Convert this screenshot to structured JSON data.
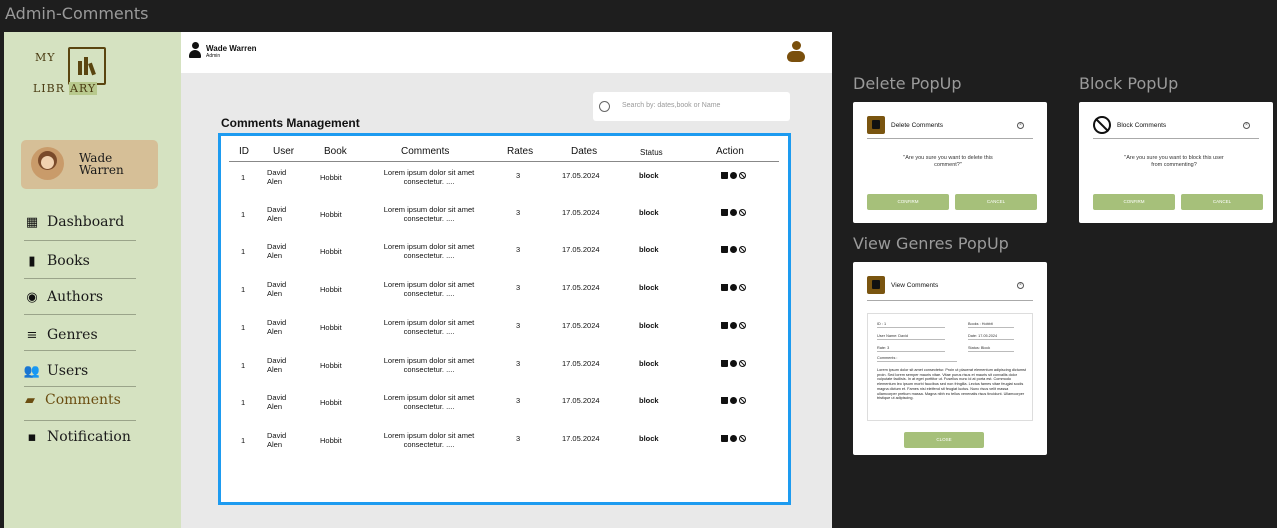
{
  "canvas_title": "Admin-Comments",
  "labels": {
    "delete_popup": "Delete PopUp",
    "block_popup": "Block PopUp",
    "view_popup": "View Genres PopUp"
  },
  "logo": {
    "w1": "MY",
    "w2": "LIBR",
    "w3": "ARY"
  },
  "profile": {
    "name": "Wade Warren"
  },
  "nav": [
    {
      "label": "Dashboard",
      "icon": "dashboard-icon"
    },
    {
      "label": "Books",
      "icon": "book-icon"
    },
    {
      "label": "Authors",
      "icon": "authors-icon"
    },
    {
      "label": "Genres",
      "icon": "list-icon"
    },
    {
      "label": "Users",
      "icon": "users-icon"
    },
    {
      "label": "Comments",
      "icon": "comment-icon"
    },
    {
      "label": "Notification",
      "icon": "notification-icon"
    }
  ],
  "topbar": {
    "name": "Wade Warren",
    "role": "Admin"
  },
  "search": {
    "placeholder": "Search by: dates,book or Name"
  },
  "section_title": "Comments Management",
  "table": {
    "headers": [
      "ID",
      "User",
      "Book",
      "Comments",
      "Rates",
      "Dates",
      "Status",
      "Action"
    ],
    "rows": [
      {
        "id": "1",
        "user1": "David",
        "user2": "Alen",
        "book": "Hobbit",
        "c1": "Lorem ipsum dolor sit amet",
        "c2": "consectetur. ....",
        "rate": "3",
        "date": "17.05.2024",
        "status": "block"
      },
      {
        "id": "1",
        "user1": "David",
        "user2": "Alen",
        "book": "Hobbit",
        "c1": "Lorem ipsum dolor sit amet",
        "c2": "consectetur. ....",
        "rate": "3",
        "date": "17.05.2024",
        "status": "block"
      },
      {
        "id": "1",
        "user1": "David",
        "user2": "Alen",
        "book": "Hobbit",
        "c1": "Lorem ipsum dolor sit amet",
        "c2": "consectetur. ....",
        "rate": "3",
        "date": "17.05.2024",
        "status": "block"
      },
      {
        "id": "1",
        "user1": "David",
        "user2": "Alen",
        "book": "Hobbit",
        "c1": "Lorem ipsum dolor sit amet",
        "c2": "consectetur. ....",
        "rate": "3",
        "date": "17.05.2024",
        "status": "block"
      },
      {
        "id": "1",
        "user1": "David",
        "user2": "Alen",
        "book": "Hobbit",
        "c1": "Lorem ipsum dolor sit amet",
        "c2": "consectetur. ....",
        "rate": "3",
        "date": "17.05.2024",
        "status": "block"
      },
      {
        "id": "1",
        "user1": "David",
        "user2": "Alen",
        "book": "Hobbit",
        "c1": "Lorem ipsum dolor sit amet",
        "c2": "consectetur. ....",
        "rate": "3",
        "date": "17.05.2024",
        "status": "block"
      },
      {
        "id": "1",
        "user1": "David",
        "user2": "Alen",
        "book": "Hobbit",
        "c1": "Lorem ipsum dolor sit amet",
        "c2": "consectetur. ....",
        "rate": "3",
        "date": "17.05.2024",
        "status": "block"
      },
      {
        "id": "1",
        "user1": "David",
        "user2": "Alen",
        "book": "Hobbit",
        "c1": "Lorem ipsum dolor sit amet",
        "c2": "consectetur. ....",
        "rate": "3",
        "date": "17.05.2024",
        "status": "block"
      }
    ]
  },
  "delete_popup": {
    "title": "Delete Comments",
    "message": "\"Are you sure you want to delete this comment?\"",
    "confirm": "CONFIRM",
    "cancel": "CANCEL"
  },
  "block_popup": {
    "title": "Block Comments",
    "message": "\"Are you sure you want to block this user from commenting?",
    "confirm": "CONFIRM",
    "cancel": "CANCEL"
  },
  "view_popup": {
    "title": "View Comments",
    "id": "ID : 1",
    "books": "Books : Hobbit",
    "user_name": "User Name: David",
    "date": "Date: 17.05.2024",
    "rate": "Rate: 3",
    "status": "Status: Block",
    "comments_label": "Comments :",
    "comment_text": "Lorem ipsum dolor sit amet consectetur. Proin ut placerat elementum adipiscing dictumst proin. Sed lorem semper mauris vitae. Vitae purus risus et mauris sit convallis dolor vulputate facilisis. In at eget porttitor ut. Fusellus nunc id at porta est. Commodo elementum leo ipsum morbi faucibus sed non fringilla. Lectus fames vitae feugiat sociis magna dictum et. Fames nisi eleifend sit feugiat luctus. Nunc risus velit massa ullamcorper pretium massa. Magna nibh eu tellus venenatis risus tincidunt. Ullamcorper tristique ut adipiscing.",
    "close": "CLOSE"
  }
}
